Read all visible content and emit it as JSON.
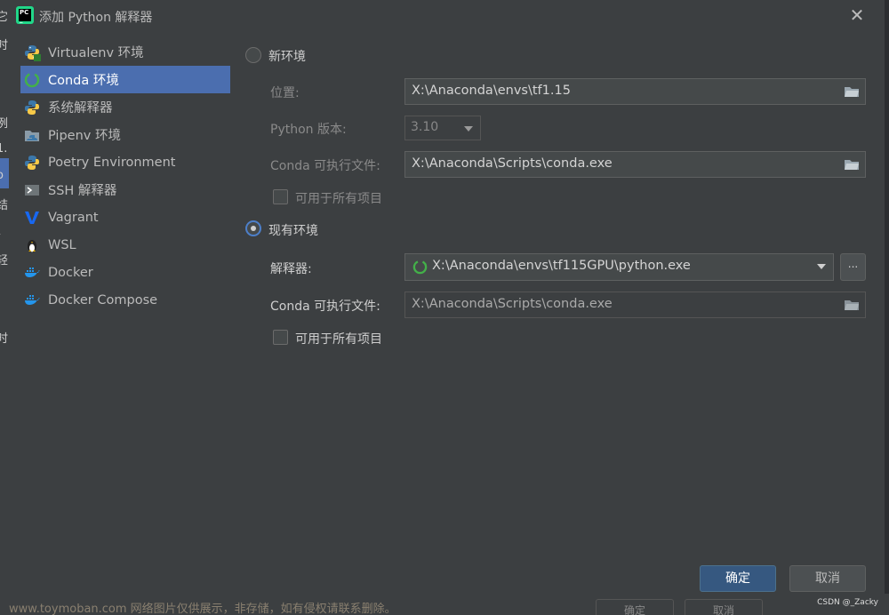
{
  "window": {
    "title": "添加 Python 解释器"
  },
  "sidebar": {
    "items": [
      {
        "label": "Virtualenv 环境",
        "icon": "python-icon"
      },
      {
        "label": "Conda 环境",
        "icon": "conda-icon",
        "active": true
      },
      {
        "label": "系统解释器",
        "icon": "python-icon"
      },
      {
        "label": "Pipenv 环境",
        "icon": "pipenv-icon"
      },
      {
        "label": "Poetry Environment",
        "icon": "poetry-icon"
      },
      {
        "label": "SSH 解释器",
        "icon": "ssh-terminal-icon"
      },
      {
        "label": "Vagrant",
        "icon": "vagrant-icon"
      },
      {
        "label": "WSL",
        "icon": "linux-penguin-icon"
      },
      {
        "label": "Docker",
        "icon": "docker-icon"
      },
      {
        "label": "Docker Compose",
        "icon": "docker-icon"
      }
    ]
  },
  "new_env": {
    "radio_label": "新环境",
    "location_label": "位置:",
    "location_value": "X:\\Anaconda\\envs\\tf1.15",
    "python_version_label": "Python 版本:",
    "python_version_value": "3.10",
    "conda_exec_label": "Conda 可执行文件:",
    "conda_exec_value": "X:\\Anaconda\\Scripts\\conda.exe",
    "all_projects_label": "可用于所有项目"
  },
  "existing_env": {
    "radio_label": "现有环境",
    "interpreter_label": "解释器:",
    "interpreter_value": "X:\\Anaconda\\envs\\tf115GPU\\python.exe",
    "browse_label": "...",
    "conda_exec_label": "Conda 可执行文件:",
    "conda_exec_value": "X:\\Anaconda\\Scripts\\conda.exe",
    "all_projects_label": "可用于所有项目"
  },
  "footer": {
    "ok_label": "确定",
    "cancel_label": "取消"
  },
  "background": {
    "left_fragments": [
      "它",
      "时",
      "例",
      "1.",
      "o",
      "结",
      "\\",
      "轻",
      "时"
    ],
    "bottom_buttons": [
      "确定",
      "取消"
    ]
  },
  "watermark": {
    "text": "www.toymoban.com 网络图片仅供展示，非存储，如有侵权请联系删除。",
    "credit": "CSDN @_Zacky"
  },
  "colors": {
    "accent": "#4b6eaf",
    "primary_button": "#365880",
    "dialog_bg": "#3c3f41"
  }
}
